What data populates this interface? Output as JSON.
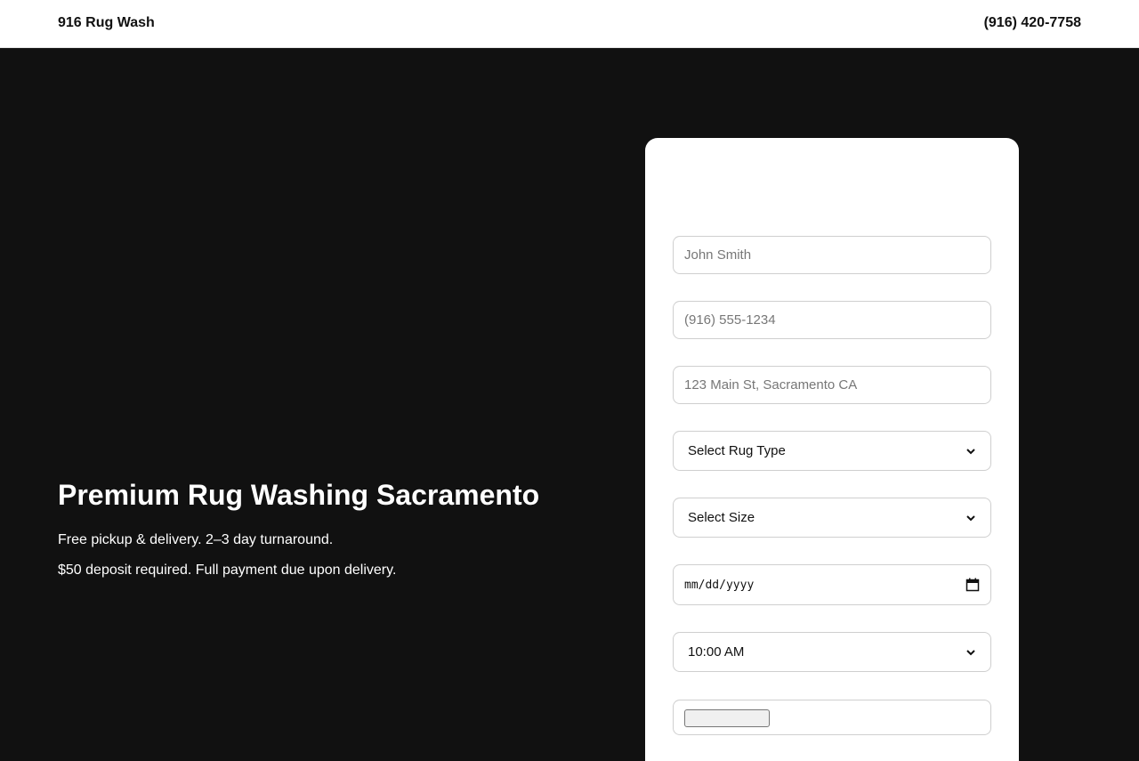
{
  "header": {
    "brand": "916 Rug Wash",
    "phone": "(916) 420-7758"
  },
  "hero": {
    "title": "Premium Rug Washing Sacramento",
    "line1": "Free pickup & delivery. 2–3 day turnaround.",
    "line2": "$50 deposit required. Full payment due upon delivery."
  },
  "form": {
    "name_placeholder": "John Smith",
    "phone_placeholder": "(916) 555-1234",
    "address_placeholder": "123 Main St, Sacramento CA",
    "rug_type_selected": "Select Rug Type",
    "size_selected": "Select Size",
    "date_placeholder": "mm/dd/yyyy",
    "time_selected": "10:00 AM"
  },
  "colors": {
    "hero_background": "#111111",
    "header_background": "#ffffff",
    "card_background": "#ffffff",
    "field_border": "#cfcfcf"
  },
  "icons": {
    "select_arrow": "chevron-down-icon",
    "date_picker": "calendar-icon"
  }
}
